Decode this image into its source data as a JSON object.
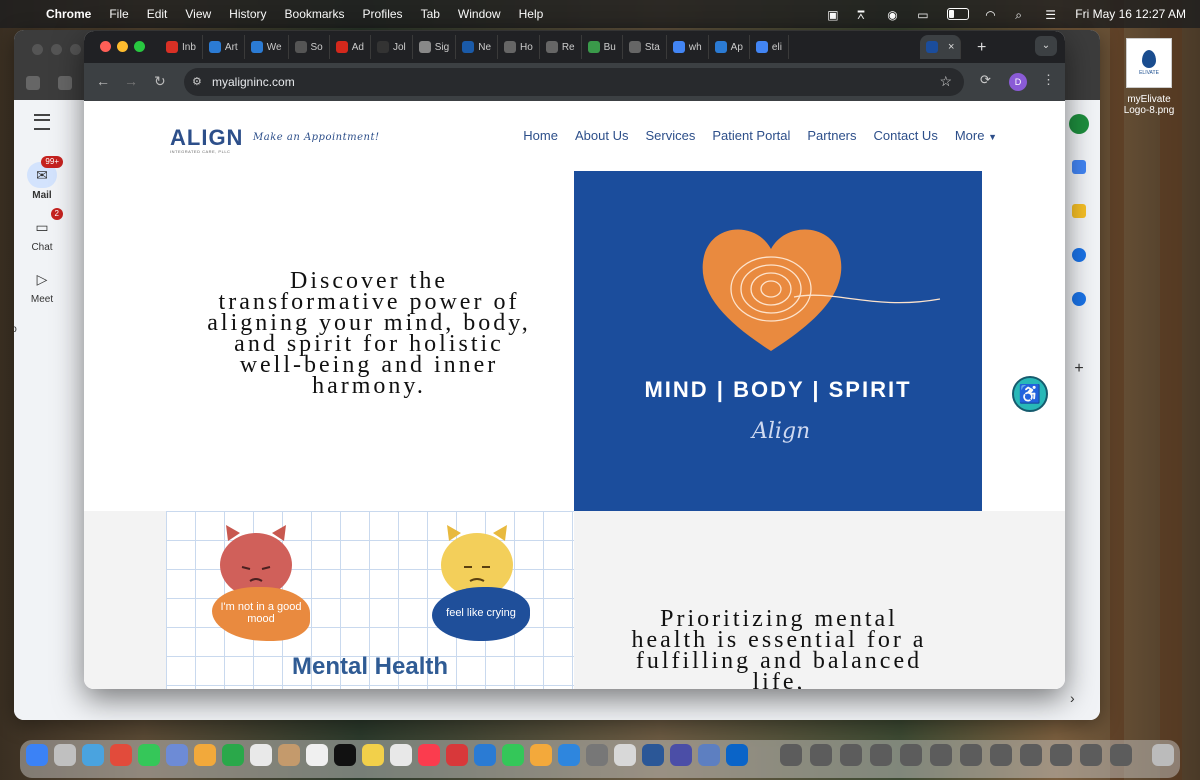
{
  "menubar": {
    "app": "Chrome",
    "items": [
      "File",
      "Edit",
      "View",
      "History",
      "Bookmarks",
      "Profiles",
      "Tab",
      "Window",
      "Help"
    ],
    "datetime": "Fri May 16  12:27 AM"
  },
  "desktop": {
    "icon_label_1": "myElivate",
    "icon_label_2": "Logo-8.png",
    "thumb_text": "ELIVATE"
  },
  "gmail": {
    "mail_label": "Mail",
    "mail_badge": "99+",
    "chat_label": "Chat",
    "chat_badge": "2",
    "meet_label": "Meet",
    "partial_text": "Co"
  },
  "browser": {
    "tabs": [
      {
        "icon": "gmail-icon",
        "label": "Inb",
        "color": "#d93025"
      },
      {
        "icon": "ev-icon",
        "label": "Art",
        "color": "#2b7bd4"
      },
      {
        "icon": "ev-icon",
        "label": "We",
        "color": "#2b7bd4"
      },
      {
        "icon": "openai-icon",
        "label": "So",
        "color": "#555555"
      },
      {
        "icon": "adobe-icon",
        "label": "Ad",
        "color": "#d4281c"
      },
      {
        "icon": "profile-icon",
        "label": "Jol",
        "color": "#333333"
      },
      {
        "icon": "doc-icon",
        "label": "Sig",
        "color": "#888888"
      },
      {
        "icon": "nc-icon",
        "label": "Ne",
        "color": "#1a5aa8"
      },
      {
        "icon": "globe-icon",
        "label": "Ho",
        "color": "#666666"
      },
      {
        "icon": "globe-icon",
        "label": "Re",
        "color": "#666666"
      },
      {
        "icon": "bu-icon",
        "label": "Bu",
        "color": "#3a9a4a"
      },
      {
        "icon": "globe-icon",
        "label": "Sta",
        "color": "#666666"
      },
      {
        "icon": "google-icon",
        "label": "wh",
        "color": "#4285f4"
      },
      {
        "icon": "ev-icon",
        "label": "Ap",
        "color": "#2b7bd4"
      },
      {
        "icon": "google-icon",
        "label": "eli",
        "color": "#4285f4"
      }
    ],
    "active_tab_close": "×",
    "new_tab": "+",
    "url": "myaligninc.com",
    "profile_initial": "D"
  },
  "site": {
    "logo": "ALIGN",
    "logo_sub": "INTEGRATED CARE, PLLC",
    "tagline": "Make an Appointment!",
    "nav": [
      "Home",
      "About Us",
      "Services",
      "Patient Portal",
      "Partners",
      "Contact Us",
      "More"
    ],
    "hero_text": "Discover the transformative power of aligning your mind, body, and spirit for holistic well-being and inner harmony.",
    "hero_image_caption": "MIND | BODY | SPIRIT",
    "hero_image_signature": "Align",
    "mh_bubble_1": "I'm not in a good mood",
    "mh_bubble_2": "feel like crying",
    "mh_title": "Mental Health",
    "mh_text": "Prioritizing mental health is essential for a fulfilling and balanced life,"
  },
  "colors": {
    "brand_blue": "#2d4f8a",
    "hero_blue": "#1b4d9c",
    "accent_orange": "#e07a33",
    "a11y_teal": "#28b8b8"
  }
}
